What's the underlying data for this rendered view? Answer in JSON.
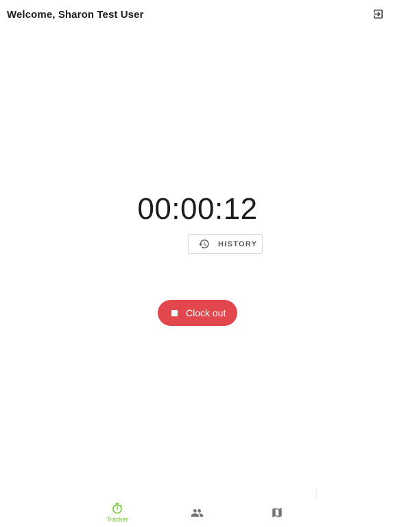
{
  "header": {
    "title": "Welcome, Sharon Test User",
    "logout_icon": "logout-icon"
  },
  "timer": {
    "elapsed": "00:00:12"
  },
  "history_button": {
    "icon": "history-icon",
    "label": "HISTORY"
  },
  "clockout_button": {
    "icon": "stop-icon",
    "label": "Clock out",
    "color": "#e2474d"
  },
  "bottom_nav": {
    "items": [
      {
        "label": "Tracker",
        "icon": "stopwatch-icon",
        "active": true
      },
      {
        "label": "",
        "icon": "people-icon",
        "active": false
      },
      {
        "label": "",
        "icon": "map-icon",
        "active": false
      }
    ],
    "active_color": "#6cc52a",
    "inactive_color": "#757575"
  }
}
